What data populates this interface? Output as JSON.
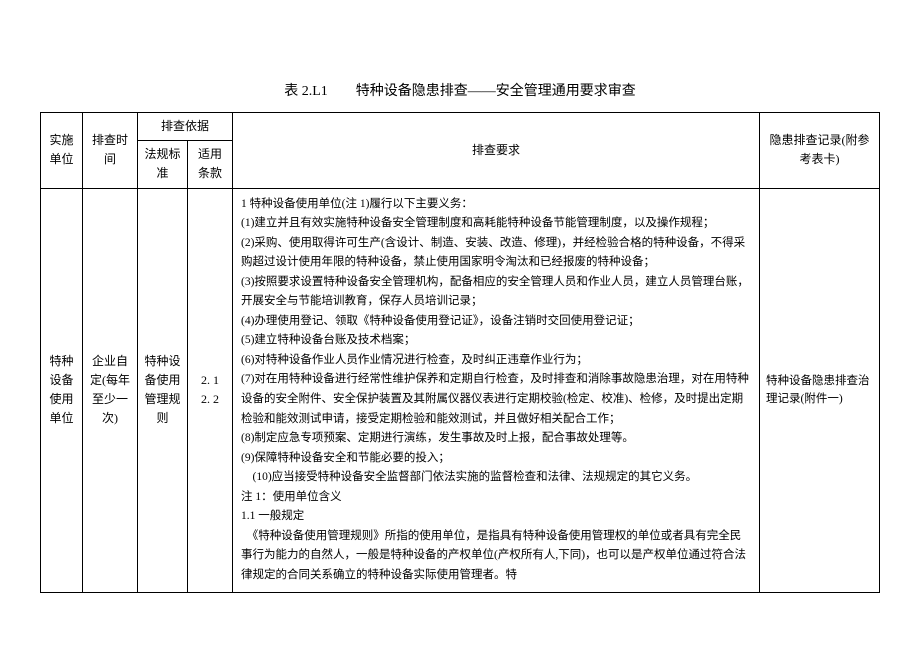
{
  "title": "表 2.L1　　特种设备隐患排查——安全管理通用要求审查",
  "headers": {
    "unit": "实施单位",
    "time": "排查时间",
    "basis": "排查依据",
    "law": "法规标准",
    "clause": "适用条款",
    "requirement": "排查要求",
    "record": "隐患排查记录(附参考表卡)"
  },
  "row": {
    "unit": "特种设备使用单位",
    "time": "企业自定(每年至少一次)",
    "law": "特种设备使用管理规则",
    "clause": "2. 1\n2. 2",
    "requirement": "1 特种设备使用单位(注 1)履行以下主要义务：\n(1)建立并且有效实施特种设备安全管理制度和高耗能特种设备节能管理制度，以及操作规程；\n(2)采购、使用取得许可生产(含设计、制造、安装、改造、修理)，并经检验合格的特种设备，不得采购超过设计使用年限的特种设备，禁止使用国家明令淘汰和已经报废的特种设备；\n(3)按照要求设置特种设备安全管理机构，配备相应的安全管理人员和作业人员，建立人员管理台账，开展安全与节能培训教育，保存人员培训记录；\n(4)办理使用登记、领取《特种设备使用登记证》，设备注销时交回使用登记证；\n(5)建立特种设备台账及技术档案；\n(6)对特种设备作业人员作业情况进行检查，及时纠正违章作业行为；\n(7)对在用特种设备进行经常性维护保养和定期自行检查，及时排查和消除事故隐患治理，对在用特种设备的安全附件、安全保护装置及其附属仪器仪表进行定期校验(检定、校准)、检修，及时提出定期检验和能效测试申请，接受定期检验和能效测试，并且做好相关配合工作；\n(8)制定应急专项预案、定期进行演练，发生事故及时上报，配合事故处理等。\n(9)保障特种设备安全和节能必要的投入；\n　(10)应当接受特种设备安全监督部门依法实施的监督检查和法律、法规规定的其它义务。\n注 1：使用单位含义\n1.1 一般规定\n　《特种设备使用管理规则》所指的使用单位，是指具有特种设备使用管理权的单位或者具有完全民事行为能力的自然人，一般是特种设备的产权单位(产权所有人,下同)，也可以是产权单位通过符合法律规定的合同关系确立的特种设备实际使用管理者。特",
    "record": "特种设备隐患排查治理记录(附件一)"
  }
}
